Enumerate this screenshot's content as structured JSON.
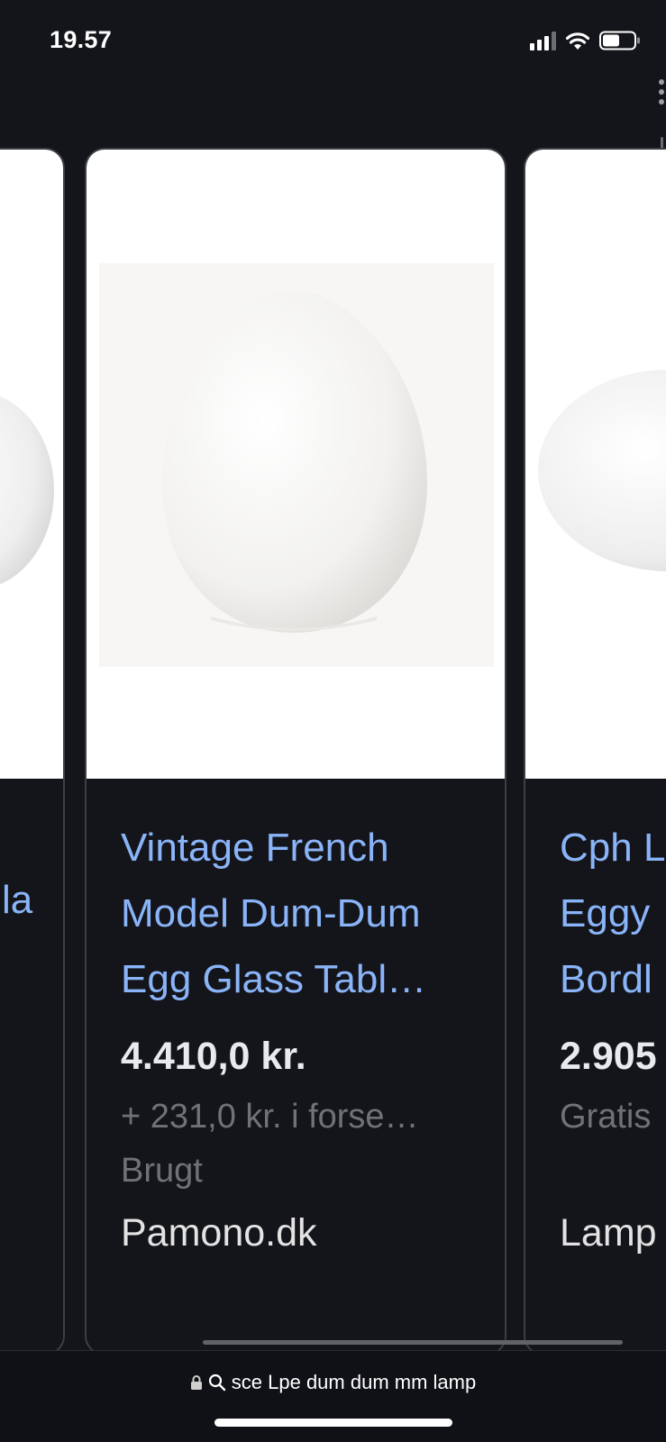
{
  "status_bar": {
    "time": "19.57",
    "signal_icon": "cellular-signal-icon",
    "wifi_icon": "wifi-icon",
    "battery_icon": "battery-icon"
  },
  "cards": {
    "left": {
      "title_fragment": "la"
    },
    "main": {
      "title_lines": [
        "Vintage French",
        "Model Dum-Dum",
        "Egg Glass Tabl…"
      ],
      "price": "4.410,0 kr.",
      "shipping": "+ 231,0 kr. i forse…",
      "condition": "Brugt",
      "seller": "Pamono.dk"
    },
    "right": {
      "title_lines": [
        "Cph L",
        "Eggy",
        "Bordl"
      ],
      "price": "2.905",
      "shipping": "Gratis",
      "seller": "Lamp"
    }
  },
  "address_bar": {
    "lock_icon": "lock-icon",
    "search_icon": "search-icon",
    "url_text": "sce Lpe dum dum mm lamp"
  },
  "colors": {
    "background": "#14151b",
    "title_link": "#8ab4f8",
    "price_text": "#e8eaed",
    "muted_text": "#6f7276",
    "card_border": "#3c4043"
  }
}
